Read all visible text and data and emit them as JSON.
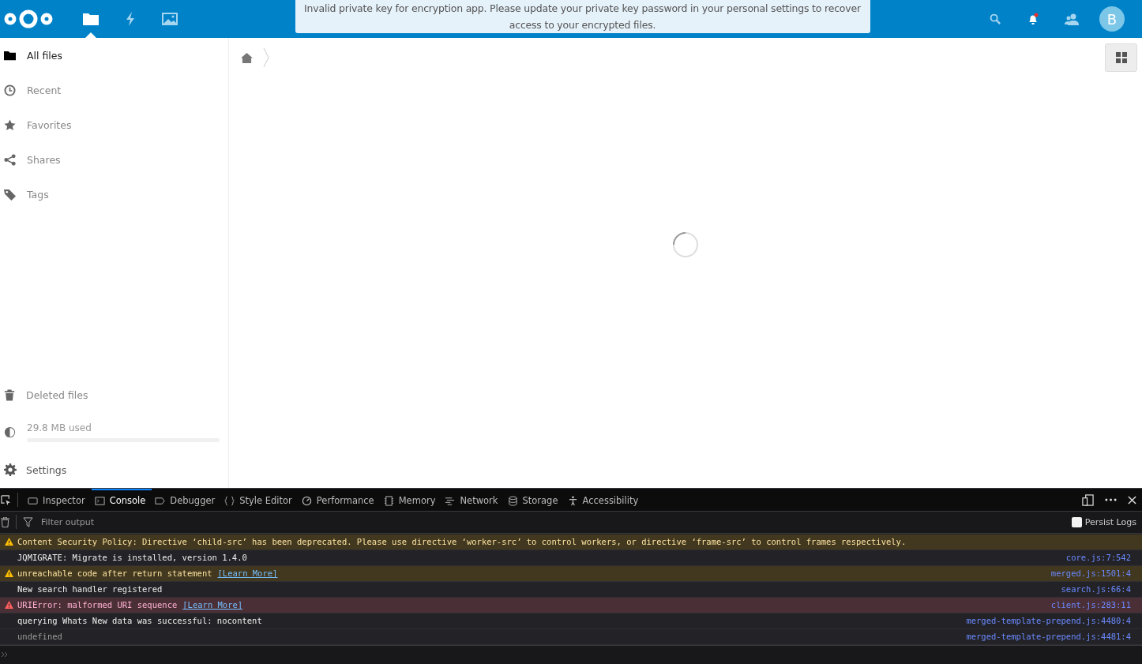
{
  "header": {
    "apps": [
      {
        "kind": "files",
        "selected": true
      },
      {
        "kind": "activity",
        "selected": false
      },
      {
        "kind": "gallery",
        "selected": false
      }
    ],
    "notice": "Invalid private key for encryption app. Please update your private key password in your personal settings to recover access to your encrypted files.",
    "avatar": "B",
    "notification_unread": true
  },
  "sidebar": {
    "items": [
      {
        "kind": "folder",
        "label": "All files",
        "selected": true
      },
      {
        "kind": "recent",
        "label": "Recent",
        "selected": false
      },
      {
        "kind": "star",
        "label": "Favorites",
        "selected": false
      },
      {
        "kind": "share",
        "label": "Shares",
        "selected": false
      },
      {
        "kind": "tag",
        "label": "Tags",
        "selected": false
      }
    ],
    "deleted": "Deleted files",
    "quota": {
      "label": "29.8 MB used",
      "level": 0
    },
    "settings": "Settings"
  },
  "devtools": {
    "tabs": [
      {
        "kind": "inspector",
        "label": "Inspector",
        "selected": false
      },
      {
        "kind": "console",
        "label": "Console",
        "selected": true
      },
      {
        "kind": "debugger",
        "label": "Debugger",
        "selected": false
      },
      {
        "kind": "style",
        "label": "Style Editor",
        "selected": false
      },
      {
        "kind": "performance",
        "label": "Performance",
        "selected": false
      },
      {
        "kind": "memory",
        "label": "Memory",
        "selected": false
      },
      {
        "kind": "network",
        "label": "Network",
        "selected": false
      },
      {
        "kind": "storage",
        "label": "Storage",
        "selected": false
      },
      {
        "kind": "accessibility",
        "label": "Accessibility",
        "selected": false
      }
    ],
    "filter_placeholder": "Filter output",
    "persist_logs": {
      "label": "Persist Logs",
      "checked": false
    },
    "messages": [
      {
        "kind": "warning",
        "text": "Content Security Policy: Directive ‘child-src’ has been deprecated. Please use directive ‘worker-src’ to control workers, or directive ‘frame-src’ to control frames respectively."
      },
      {
        "kind": "log",
        "text": "JQMIGRATE: Migrate is installed, version 1.4.0",
        "source": "core.js:7:542"
      },
      {
        "kind": "warning",
        "text": "unreachable code after return statement",
        "link": "[Learn More]",
        "source": "merged.js:1501:4"
      },
      {
        "kind": "log",
        "text": "New search handler registered",
        "source": "search.js:66:4"
      },
      {
        "kind": "error",
        "text": "URIError: malformed URI sequence",
        "link": "[Learn More]",
        "source": "client.js:283:11"
      },
      {
        "kind": "log",
        "text": "querying Whats New data was successful: nocontent",
        "source": "merged-template-prepend.js:4480:4"
      },
      {
        "kind": "undefined",
        "text": "undefined",
        "source": "merged-template-prepend.js:4481:4"
      }
    ]
  }
}
